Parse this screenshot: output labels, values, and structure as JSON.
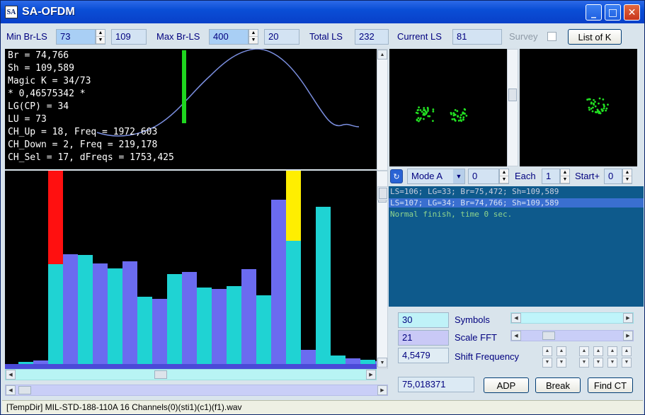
{
  "window": {
    "title": "SA-OFDM",
    "icon": "SA"
  },
  "titlebar_buttons": {
    "minimize": "_",
    "maximize": "□",
    "close": "✕"
  },
  "toolbar": {
    "min_brls_label": "Min Br-LS",
    "min_brls_value": "73",
    "min_brls_extra": "109",
    "max_brls_label": "Max Br-LS",
    "max_brls_value": "400",
    "max_brls_extra": "20",
    "total_ls_label": "Total LS",
    "total_ls_value": "232",
    "current_ls_label": "Current LS",
    "current_ls_value": "81",
    "survey_label": "Survey",
    "list_button": "List of K"
  },
  "info": [
    "Br = 74,766",
    "Sh = 109,589",
    "Magic K = 34/73",
    "* 0,46575342 *",
    "LG(CP) = 34",
    "LU = 73",
    "CH_Up = 18, Freq = 1972,603",
    "CH_Down = 2, Freq = 219,178",
    "CH_Sel = 17, dFreqs = 1753,425"
  ],
  "bar_chart": {
    "colors": {
      "cyan": "#1fd3d3",
      "purple": "#6b6bf0",
      "red": "#ff1010",
      "yellow": "#ffee00"
    },
    "bars": [
      {
        "color": "cyan",
        "value": 3
      },
      {
        "color": "purple",
        "value": 5
      },
      {
        "color": "cyan",
        "value": 141,
        "cap": "red",
        "cap_value": 280
      },
      {
        "color": "purple",
        "value": 155
      },
      {
        "color": "cyan",
        "value": 154
      },
      {
        "color": "purple",
        "value": 142
      },
      {
        "color": "cyan",
        "value": 135
      },
      {
        "color": "purple",
        "value": 145
      },
      {
        "color": "cyan",
        "value": 95
      },
      {
        "color": "purple",
        "value": 92
      },
      {
        "color": "cyan",
        "value": 127
      },
      {
        "color": "purple",
        "value": 130
      },
      {
        "color": "cyan",
        "value": 108
      },
      {
        "color": "purple",
        "value": 106
      },
      {
        "color": "cyan",
        "value": 110
      },
      {
        "color": "purple",
        "value": 134
      },
      {
        "color": "cyan",
        "value": 97
      },
      {
        "color": "purple",
        "value": 232
      },
      {
        "color": "cyan",
        "value": 174,
        "cap": "yellow",
        "cap_value": 280
      },
      {
        "color": "purple",
        "value": 20
      },
      {
        "color": "cyan",
        "value": 222
      },
      {
        "color": "cyan",
        "value": 12
      },
      {
        "color": "purple",
        "value": 8
      },
      {
        "color": "cyan",
        "value": 6
      },
      {
        "color": "purple",
        "value": 4
      },
      {
        "color": "cyan",
        "value": 3
      }
    ]
  },
  "mode": {
    "mode_value": "Mode A",
    "mode_num": "0",
    "each_label": "Each",
    "each_value": "1",
    "start_label": "Start+",
    "start_value": "0"
  },
  "log": [
    "LS=106; LG=33; Br=75,472; Sh=109,589",
    "LS=107; LG=34; Br=74,766; Sh=109,589",
    "Normal finish, time 0 sec."
  ],
  "params": {
    "symbols_value": "30",
    "symbols_label": "Symbols",
    "scale_value": "21",
    "scale_label": "Scale FFT",
    "shift_value": "4,5479",
    "shift_label": "Shift Frequency",
    "result_value": "75,018371"
  },
  "actions": {
    "adp": "ADP",
    "break": "Break",
    "find_ct": "Find CT"
  },
  "status": "[TempDir] MIL-STD-188-110A 16 Channels(0)(sti1)(c1)(f1).wav"
}
